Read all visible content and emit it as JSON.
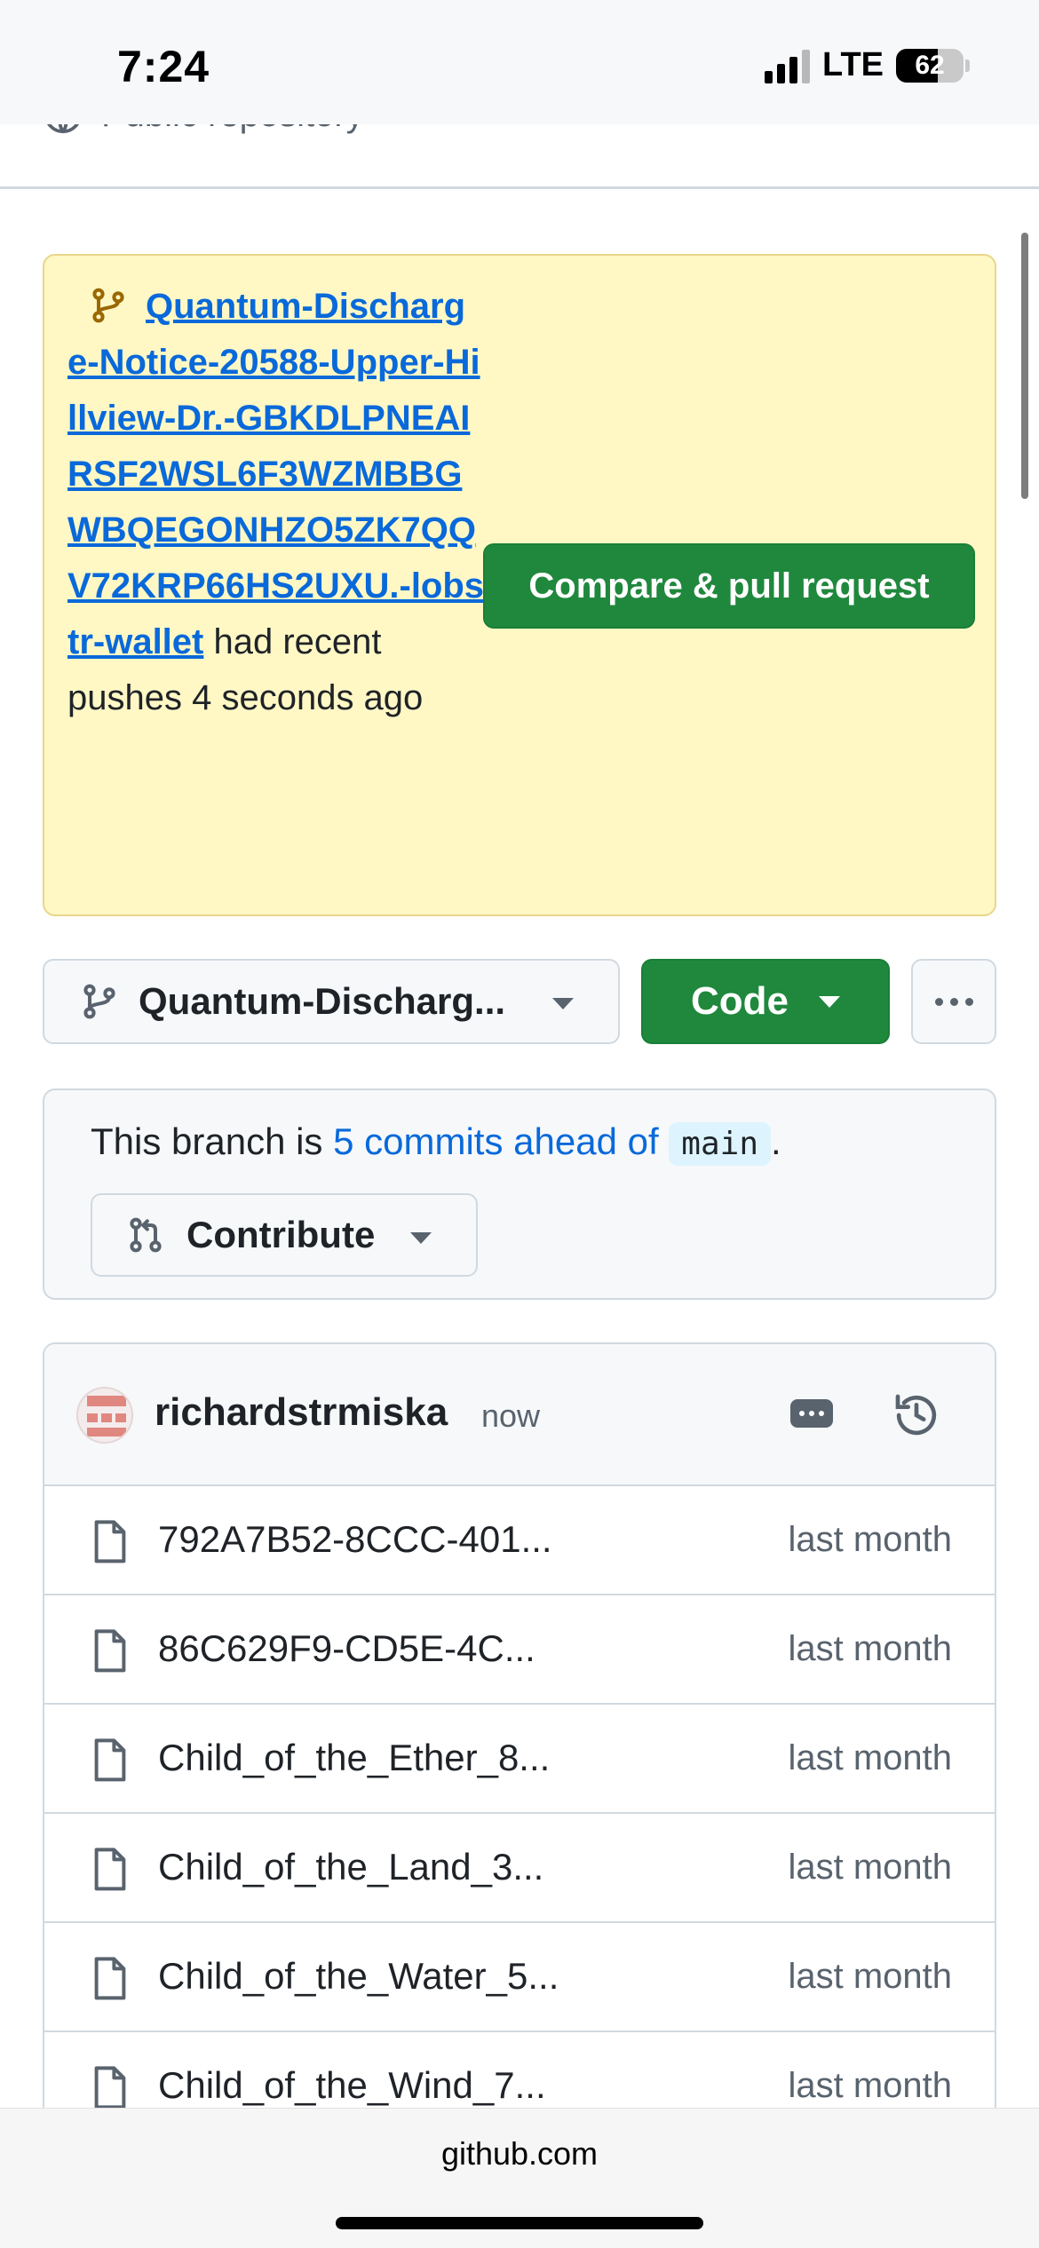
{
  "status_bar": {
    "time": "7:24",
    "network": "LTE",
    "battery_level": "62",
    "battery_fraction": 0.62
  },
  "repo": {
    "visibility_label": "Public repository"
  },
  "push_banner": {
    "branch_name": "Quantum-Discharge-Notice-20588-Upper-Hillview-Dr.-GBKDLPNEAIRSF2WSL6F3WZMBBGWBQEGONHZO5ZK7QQV72KRP66HS2UXU.-lobstr-wallet",
    "suffix": " had recent pushes 4 seconds ago",
    "compare_button": "Compare & pull request"
  },
  "toolbar": {
    "branch_selector": "Quantum-Discharg...",
    "code_button": "Code"
  },
  "ahead": {
    "prefix": "This branch is ",
    "link": "5 commits ahead of",
    "base_branch": "main",
    "suffix": ".",
    "contribute_button": "Contribute"
  },
  "latest_commit": {
    "author": "richardstrmiska",
    "time": "now"
  },
  "files": [
    {
      "name": "792A7B52-8CCC-401...",
      "date": "last month"
    },
    {
      "name": "86C629F9-CD5E-4C...",
      "date": "last month"
    },
    {
      "name": "Child_of_the_Ether_8...",
      "date": "last month"
    },
    {
      "name": "Child_of_the_Land_3...",
      "date": "last month"
    },
    {
      "name": "Child_of_the_Water_5...",
      "date": "last month"
    },
    {
      "name": "Child_of_the_Wind_7...",
      "date": "last month"
    }
  ],
  "browser": {
    "address": "github.com"
  },
  "colors": {
    "accent_green": "#1f883d",
    "link_blue": "#0969da",
    "banner_bg": "#fff8c5"
  }
}
